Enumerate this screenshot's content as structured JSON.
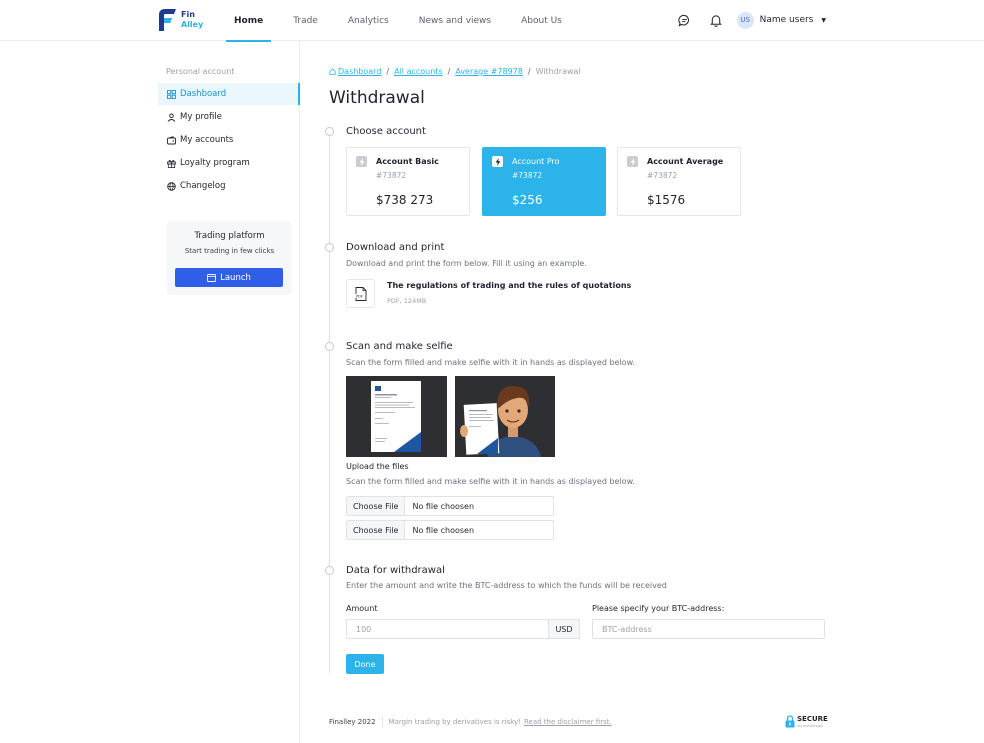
{
  "brand": {
    "line1": "Fin",
    "line2": "Alley"
  },
  "nav": {
    "items": [
      {
        "label": "Home",
        "active": true
      },
      {
        "label": "Trade",
        "active": false
      },
      {
        "label": "Analytics",
        "active": false
      },
      {
        "label": "News and views",
        "active": false
      },
      {
        "label": "About Us",
        "active": false
      }
    ]
  },
  "user": {
    "initials": "US",
    "name": "Name users",
    "caret": "▼"
  },
  "sidebar": {
    "heading": "Personal account",
    "items": [
      {
        "label": "Dashboard",
        "icon": "dashboard-icon",
        "active": true
      },
      {
        "label": "My profile",
        "icon": "user-icon",
        "active": false
      },
      {
        "label": "My accounts",
        "icon": "wallet-icon",
        "active": false
      },
      {
        "label": "Loyalty program",
        "icon": "gift-icon",
        "active": false
      },
      {
        "label": "Changelog",
        "icon": "globe-icon",
        "active": false
      }
    ],
    "trading": {
      "title": "Trading platform",
      "subtitle": "Start trading in few clicks",
      "button": "Launch"
    }
  },
  "breadcrumb": {
    "items": [
      "Dashboard",
      "All accounts",
      "Average #78978"
    ],
    "current": "Withdrawal"
  },
  "page_title": "Withdrawal",
  "steps": {
    "choose": {
      "title": "Choose account"
    },
    "download": {
      "title": "Download and print",
      "subtitle": "Download and print the form below. Fill it using an example."
    },
    "scan": {
      "title": "Scan and make selfie",
      "subtitle": "Scan the form filled and make selfie with it in hands as displayed below."
    },
    "data": {
      "title": "Data for withdrawal",
      "subtitle": "Enter the amount and write the BTC-address to which the funds will be received"
    }
  },
  "accounts": [
    {
      "name": "Account Basic",
      "number": "#73872",
      "balance": "$738 273",
      "selected": false
    },
    {
      "name": "Account Pro",
      "number": "#73872",
      "balance": "$256",
      "selected": true
    },
    {
      "name": "Account Average",
      "number": "#73872",
      "balance": "$1576",
      "selected": false
    }
  ],
  "document": {
    "title": "The regulations of trading and the rules of quotations",
    "meta": "PDF, 124MB",
    "icon_label": "PDF"
  },
  "upload": {
    "label": "Upload the files",
    "subtitle": "Scan the form filled and make selfie with it in hands as displayed below.",
    "files": [
      {
        "button": "Choose File",
        "status": "No file choosen"
      },
      {
        "button": "Choose File",
        "status": "No file choosen"
      }
    ]
  },
  "withdrawal": {
    "amount_label": "Amount",
    "amount_placeholder": "100",
    "currency": "USD",
    "btc_label": "Please specify your BTC-address:",
    "btc_placeholder": "BTC-address",
    "submit": "Done"
  },
  "footer": {
    "brand": "Finalley 2022",
    "warning": "Margin trading by derivatives is risky!",
    "link": "Read the disclaimer first.",
    "secure": "SECURE",
    "secure_sub": "SSL ENCRYPTION"
  },
  "colors": {
    "accent": "#2bb3ea",
    "primary_button": "#2f5fe8",
    "brand_dark": "#1d3b8f"
  }
}
